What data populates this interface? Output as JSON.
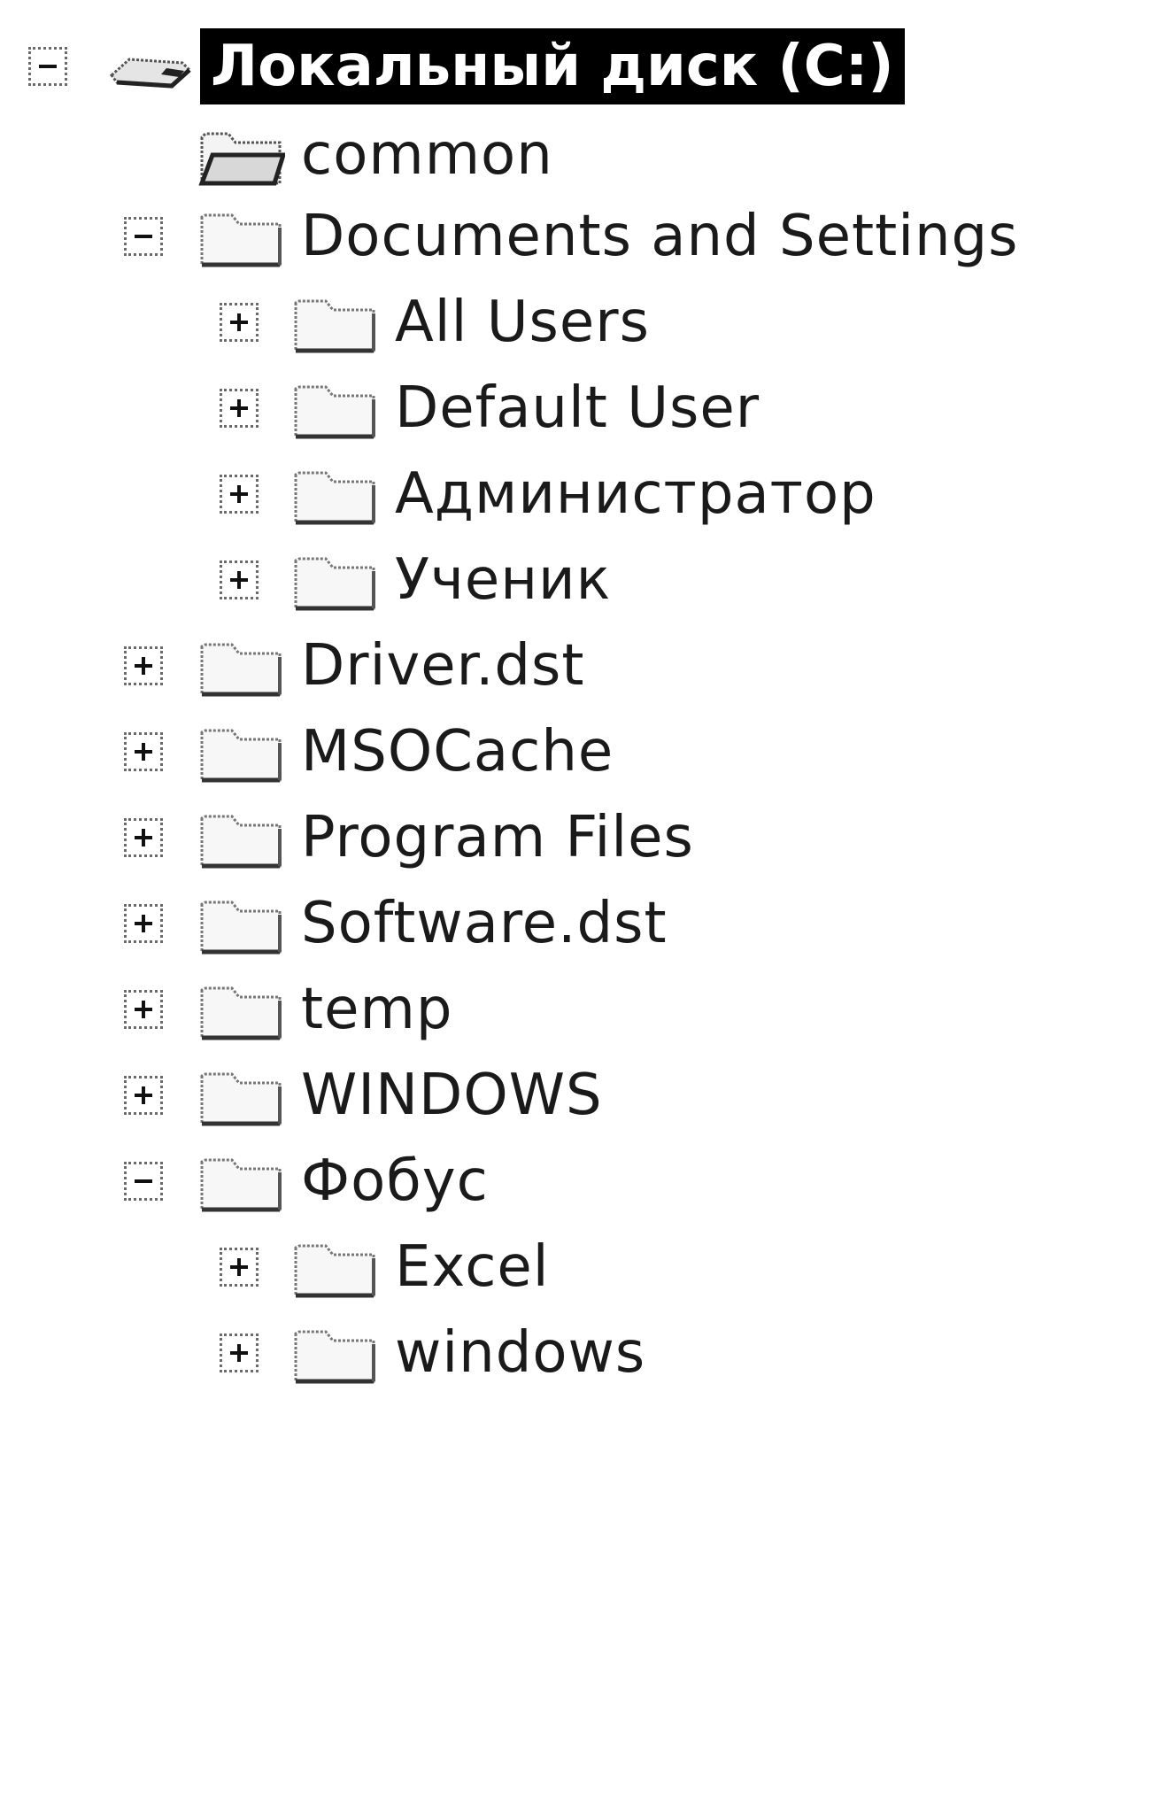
{
  "tree": {
    "root": {
      "label": "Локальный диск (C:)",
      "expanded": true,
      "selected": true,
      "icon": "drive-icon"
    },
    "items": [
      {
        "label": "common",
        "expanded": null,
        "icon": "folder-icon"
      },
      {
        "label": "Documents and Settings",
        "expanded": true,
        "icon": "folder-icon",
        "children": [
          {
            "label": "All Users",
            "expanded": false,
            "icon": "folder-icon"
          },
          {
            "label": "Default User",
            "expanded": false,
            "icon": "folder-icon"
          },
          {
            "label": "Администратор",
            "expanded": false,
            "icon": "folder-icon"
          },
          {
            "label": "Ученик",
            "expanded": false,
            "icon": "folder-icon"
          }
        ]
      },
      {
        "label": "Driver.dst",
        "expanded": false,
        "icon": "folder-icon"
      },
      {
        "label": "MSOCache",
        "expanded": false,
        "icon": "folder-icon"
      },
      {
        "label": "Program Files",
        "expanded": false,
        "icon": "folder-icon"
      },
      {
        "label": "Software.dst",
        "expanded": false,
        "icon": "folder-icon"
      },
      {
        "label": "temp",
        "expanded": false,
        "icon": "folder-icon"
      },
      {
        "label": "WINDOWS",
        "expanded": false,
        "icon": "folder-icon"
      },
      {
        "label": "Фобус",
        "expanded": true,
        "icon": "folder-icon",
        "children": [
          {
            "label": "Excel",
            "expanded": false,
            "icon": "folder-icon"
          },
          {
            "label": "windows",
            "expanded": false,
            "icon": "folder-icon"
          }
        ]
      }
    ]
  },
  "colors": {
    "selection": "#000000",
    "selection_text": "#ffffff",
    "text": "#1a1a1a"
  }
}
